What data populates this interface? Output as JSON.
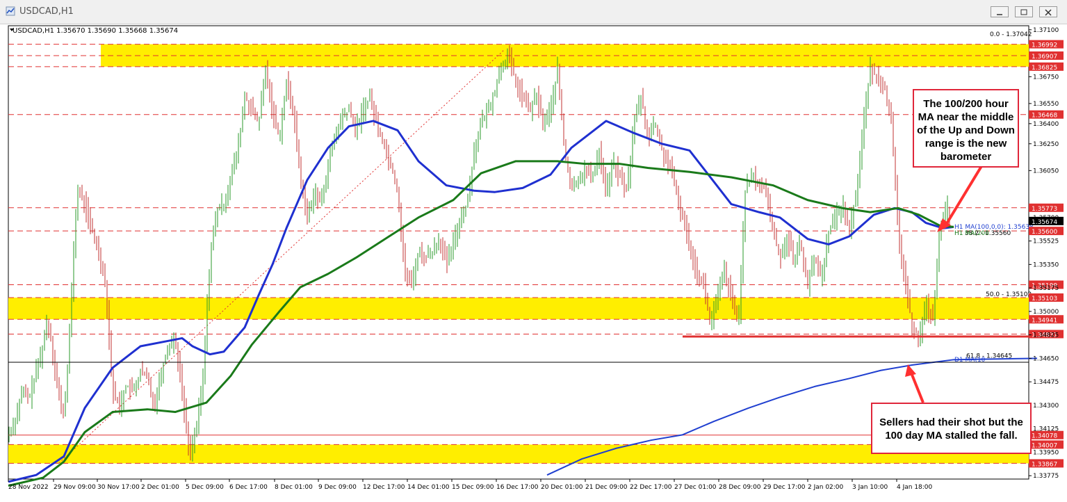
{
  "window": {
    "title": "USDCAD,H1"
  },
  "chart_data": {
    "type": "line",
    "symbol_info": "USDCAD,H1  1.35670 1.35690 1.35668 1.35674",
    "title": "",
    "xlabel": "",
    "ylabel": "",
    "ylim": [
      1.3375,
      1.3713
    ],
    "x_ticks": [
      "28 Nov 2022",
      "29 Nov 09:00",
      "30 Nov 17:00",
      "2 Dec 01:00",
      "5 Dec 09:00",
      "6 Dec 17:00",
      "8 Dec 01:00",
      "9 Dec 09:00",
      "12 Dec 17:00",
      "14 Dec 01:00",
      "15 Dec 09:00",
      "16 Dec 17:00",
      "20 Dec 01:00",
      "21 Dec 09:00",
      "22 Dec 17:00",
      "27 Dec 01:00",
      "28 Dec 09:00",
      "29 Dec 17:00",
      "2 Jan 02:00",
      "3 Jan 10:00",
      "4 Jan 18:00"
    ],
    "y_ticks": [
      "1.37100",
      "1.36750",
      "1.36550",
      "1.36400",
      "1.36250",
      "1.36050",
      "1.35700",
      "1.35525",
      "1.35350",
      "1.35175",
      "1.35000",
      "1.34825",
      "1.34650",
      "1.34475",
      "1.34300",
      "1.34125",
      "1.33950",
      "1.33775"
    ],
    "current_price": "1.35674",
    "levels": [
      {
        "price": 1.36992,
        "label": "1.36992",
        "style": "dashed",
        "color": "#e03030"
      },
      {
        "price": 1.36907,
        "label": "1.36907",
        "style": "dashed",
        "color": "#e03030"
      },
      {
        "price": 1.36825,
        "label": "1.36825",
        "style": "dashed",
        "color": "#e03030"
      },
      {
        "price": 1.36468,
        "label": "1.36468",
        "style": "dashed",
        "color": "#e03030"
      },
      {
        "price": 1.35773,
        "label": "1.35773",
        "style": "dashed",
        "color": "#e03030"
      },
      {
        "price": 1.356,
        "label": "1.35600",
        "style": "dashed",
        "color": "#e03030"
      },
      {
        "price": 1.35199,
        "label": "1.35199",
        "style": "dashed",
        "color": "#e03030"
      },
      {
        "price": 1.35103,
        "label": "1.35103",
        "style": "dashed",
        "color": "#e03030"
      },
      {
        "price": 1.34941,
        "label": "1.34941",
        "style": "dashed",
        "color": "#e03030"
      },
      {
        "price": 1.34831,
        "label": "1.34831",
        "style": "dashed",
        "color": "#e03030"
      },
      {
        "price": 1.34078,
        "label": "1.34078",
        "style": "solid",
        "color": "#e03030"
      },
      {
        "price": 1.34007,
        "label": "1.34007",
        "style": "dashed",
        "color": "#e03030"
      },
      {
        "price": 1.33867,
        "label": "1.33867",
        "style": "dashed",
        "color": "#e03030"
      }
    ],
    "zones": [
      {
        "top": 1.36992,
        "bottom": 1.36907,
        "color": "#ffee00"
      },
      {
        "top": 1.36907,
        "bottom": 1.36825,
        "color": "#ffee00"
      },
      {
        "top": 1.35103,
        "bottom": 1.34941,
        "color": "#ffee00"
      },
      {
        "top": 1.34007,
        "bottom": 1.33867,
        "color": "#ffee00"
      }
    ],
    "fib_labels": [
      {
        "text": "0.0 - 1.37042",
        "price": 1.37042
      },
      {
        "text": "38.2 - 1.35560",
        "price": 1.3556
      },
      {
        "text": "50.0 - 1.35102",
        "price": 1.35102
      },
      {
        "text": "61.8 - 1.34645",
        "price": 1.34645
      }
    ],
    "ma_labels": [
      {
        "text": "H1 MA(100,0,0): 1.35638",
        "color": "#1f3fd0"
      },
      {
        "text": "H1 MA(200",
        "color": "#1a7a1a"
      },
      {
        "text": "D1 MA(10",
        "color": "#1f3fd0"
      }
    ],
    "series": [
      {
        "name": "H1 MA(100)",
        "color": "#1f30d0",
        "values": [
          [
            0,
            1.3373
          ],
          [
            40,
            1.3378
          ],
          [
            80,
            1.3392
          ],
          [
            110,
            1.3428
          ],
          [
            150,
            1.3458
          ],
          [
            190,
            1.3474
          ],
          [
            230,
            1.3478
          ],
          [
            250,
            1.348
          ],
          [
            265,
            1.3474
          ],
          [
            290,
            1.3468
          ],
          [
            310,
            1.347
          ],
          [
            340,
            1.3488
          ],
          [
            360,
            1.3512
          ],
          [
            380,
            1.3535
          ],
          [
            400,
            1.3562
          ],
          [
            430,
            1.3598
          ],
          [
            460,
            1.3622
          ],
          [
            490,
            1.3638
          ],
          [
            525,
            1.3642
          ],
          [
            560,
            1.3635
          ],
          [
            590,
            1.3612
          ],
          [
            630,
            1.3594
          ],
          [
            670,
            1.359
          ],
          [
            700,
            1.3589
          ],
          [
            740,
            1.3592
          ],
          [
            780,
            1.3602
          ],
          [
            810,
            1.3622
          ],
          [
            860,
            1.3642
          ],
          [
            900,
            1.3633
          ],
          [
            940,
            1.3625
          ],
          [
            980,
            1.362
          ],
          [
            1010,
            1.36
          ],
          [
            1040,
            1.358
          ],
          [
            1080,
            1.3574
          ],
          [
            1110,
            1.357
          ],
          [
            1150,
            1.3554
          ],
          [
            1180,
            1.355
          ],
          [
            1210,
            1.3556
          ],
          [
            1245,
            1.3572
          ],
          [
            1275,
            1.3577
          ],
          [
            1300,
            1.3574
          ],
          [
            1320,
            1.3566
          ],
          [
            1345,
            1.3562
          ],
          [
            1360,
            1.3563
          ]
        ]
      },
      {
        "name": "H1 MA(200)",
        "color": "#1a7a1a",
        "values": [
          [
            0,
            1.337
          ],
          [
            50,
            1.3376
          ],
          [
            80,
            1.3388
          ],
          [
            110,
            1.341
          ],
          [
            150,
            1.3425
          ],
          [
            200,
            1.3427
          ],
          [
            240,
            1.3425
          ],
          [
            285,
            1.3432
          ],
          [
            320,
            1.3452
          ],
          [
            350,
            1.3475
          ],
          [
            390,
            1.35
          ],
          [
            420,
            1.3518
          ],
          [
            460,
            1.3528
          ],
          [
            500,
            1.354
          ],
          [
            545,
            1.3555
          ],
          [
            590,
            1.357
          ],
          [
            640,
            1.3583
          ],
          [
            680,
            1.3603
          ],
          [
            730,
            1.3612
          ],
          [
            790,
            1.3612
          ],
          [
            830,
            1.361
          ],
          [
            880,
            1.361
          ],
          [
            920,
            1.3607
          ],
          [
            980,
            1.3604
          ],
          [
            1040,
            1.36
          ],
          [
            1100,
            1.3594
          ],
          [
            1150,
            1.3583
          ],
          [
            1200,
            1.3577
          ],
          [
            1240,
            1.3574
          ],
          [
            1280,
            1.3577
          ],
          [
            1310,
            1.3572
          ],
          [
            1340,
            1.3564
          ],
          [
            1360,
            1.3563
          ]
        ]
      },
      {
        "name": "D1 MA(100)",
        "color": "#1f3fd0",
        "values": [
          [
            775,
            1.3378
          ],
          [
            825,
            1.339
          ],
          [
            875,
            1.3398
          ],
          [
            925,
            1.3404
          ],
          [
            970,
            1.3408
          ],
          [
            1015,
            1.3418
          ],
          [
            1065,
            1.3428
          ],
          [
            1110,
            1.3436
          ],
          [
            1160,
            1.3444
          ],
          [
            1210,
            1.345
          ],
          [
            1255,
            1.3456
          ],
          [
            1300,
            1.346
          ],
          [
            1360,
            1.3464
          ],
          [
            1480,
            1.3465
          ]
        ]
      }
    ],
    "price_path": [
      [
        0,
        1.3408
      ],
      [
        10,
        1.342
      ],
      [
        20,
        1.344
      ],
      [
        30,
        1.3435
      ],
      [
        40,
        1.3455
      ],
      [
        50,
        1.3475
      ],
      [
        55,
        1.3492
      ],
      [
        60,
        1.3485
      ],
      [
        70,
        1.3445
      ],
      [
        80,
        1.342
      ],
      [
        90,
        1.35
      ],
      [
        95,
        1.356
      ],
      [
        100,
        1.359
      ],
      [
        110,
        1.358
      ],
      [
        120,
        1.356
      ],
      [
        130,
        1.3545
      ],
      [
        140,
        1.352
      ],
      [
        150,
        1.344
      ],
      [
        160,
        1.343
      ],
      [
        170,
        1.3445
      ],
      [
        180,
        1.344
      ],
      [
        190,
        1.3455
      ],
      [
        200,
        1.345
      ],
      [
        210,
        1.343
      ],
      [
        220,
        1.3455
      ],
      [
        230,
        1.3475
      ],
      [
        240,
        1.348
      ],
      [
        250,
        1.344
      ],
      [
        260,
        1.3395
      ],
      [
        270,
        1.341
      ],
      [
        280,
        1.345
      ],
      [
        290,
        1.354
      ],
      [
        300,
        1.3575
      ],
      [
        310,
        1.358
      ],
      [
        320,
        1.36
      ],
      [
        330,
        1.362
      ],
      [
        340,
        1.366
      ],
      [
        350,
        1.365
      ],
      [
        360,
        1.364
      ],
      [
        370,
        1.368
      ],
      [
        380,
        1.365
      ],
      [
        390,
        1.363
      ],
      [
        400,
        1.367
      ],
      [
        410,
        1.365
      ],
      [
        420,
        1.36
      ],
      [
        430,
        1.357
      ],
      [
        440,
        1.359
      ],
      [
        450,
        1.358
      ],
      [
        460,
        1.361
      ],
      [
        470,
        1.363
      ],
      [
        480,
        1.3645
      ],
      [
        490,
        1.365
      ],
      [
        500,
        1.3635
      ],
      [
        510,
        1.365
      ],
      [
        520,
        1.366
      ],
      [
        530,
        1.364
      ],
      [
        540,
        1.3625
      ],
      [
        550,
        1.361
      ],
      [
        560,
        1.359
      ],
      [
        570,
        1.353
      ],
      [
        580,
        1.352
      ],
      [
        590,
        1.3545
      ],
      [
        600,
        1.354
      ],
      [
        610,
        1.3545
      ],
      [
        620,
        1.3555
      ],
      [
        630,
        1.3535
      ],
      [
        640,
        1.355
      ],
      [
        650,
        1.357
      ],
      [
        660,
        1.358
      ],
      [
        670,
        1.362
      ],
      [
        680,
        1.364
      ],
      [
        690,
        1.365
      ],
      [
        700,
        1.3665
      ],
      [
        710,
        1.3685
      ],
      [
        720,
        1.369
      ],
      [
        730,
        1.367
      ],
      [
        740,
        1.366
      ],
      [
        750,
        1.365
      ],
      [
        760,
        1.366
      ],
      [
        770,
        1.364
      ],
      [
        780,
        1.365
      ],
      [
        790,
        1.368
      ],
      [
        800,
        1.362
      ],
      [
        810,
        1.359
      ],
      [
        820,
        1.36
      ],
      [
        830,
        1.3605
      ],
      [
        840,
        1.36
      ],
      [
        850,
        1.362
      ],
      [
        860,
        1.359
      ],
      [
        870,
        1.361
      ],
      [
        880,
        1.36
      ],
      [
        890,
        1.359
      ],
      [
        900,
        1.364
      ],
      [
        910,
        1.366
      ],
      [
        920,
        1.363
      ],
      [
        930,
        1.364
      ],
      [
        940,
        1.362
      ],
      [
        950,
        1.361
      ],
      [
        960,
        1.359
      ],
      [
        970,
        1.357
      ],
      [
        980,
        1.355
      ],
      [
        990,
        1.353
      ],
      [
        1000,
        1.352
      ],
      [
        1010,
        1.349
      ],
      [
        1020,
        1.351
      ],
      [
        1030,
        1.353
      ],
      [
        1040,
        1.351
      ],
      [
        1050,
        1.349
      ],
      [
        1060,
        1.359
      ],
      [
        1070,
        1.36
      ],
      [
        1080,
        1.3595
      ],
      [
        1090,
        1.359
      ],
      [
        1100,
        1.356
      ],
      [
        1110,
        1.354
      ],
      [
        1120,
        1.3555
      ],
      [
        1130,
        1.354
      ],
      [
        1140,
        1.355
      ],
      [
        1150,
        1.352
      ],
      [
        1160,
        1.354
      ],
      [
        1170,
        1.3525
      ],
      [
        1180,
        1.356
      ],
      [
        1190,
        1.357
      ],
      [
        1200,
        1.358
      ],
      [
        1210,
        1.356
      ],
      [
        1220,
        1.359
      ],
      [
        1230,
        1.364
      ],
      [
        1240,
        1.368
      ],
      [
        1250,
        1.3675
      ],
      [
        1260,
        1.367
      ],
      [
        1270,
        1.364
      ],
      [
        1280,
        1.356
      ],
      [
        1290,
        1.352
      ],
      [
        1300,
        1.349
      ],
      [
        1310,
        1.348
      ],
      [
        1320,
        1.3505
      ],
      [
        1330,
        1.3495
      ],
      [
        1340,
        1.356
      ],
      [
        1350,
        1.358
      ],
      [
        1355,
        1.3567
      ]
    ],
    "annotations": [
      {
        "text": "The 100/200 hour MA near the middle of the Up and Down range is the new barometer"
      },
      {
        "text": "Sellers had their shot but the 100 day MA stalled the fall."
      }
    ]
  }
}
